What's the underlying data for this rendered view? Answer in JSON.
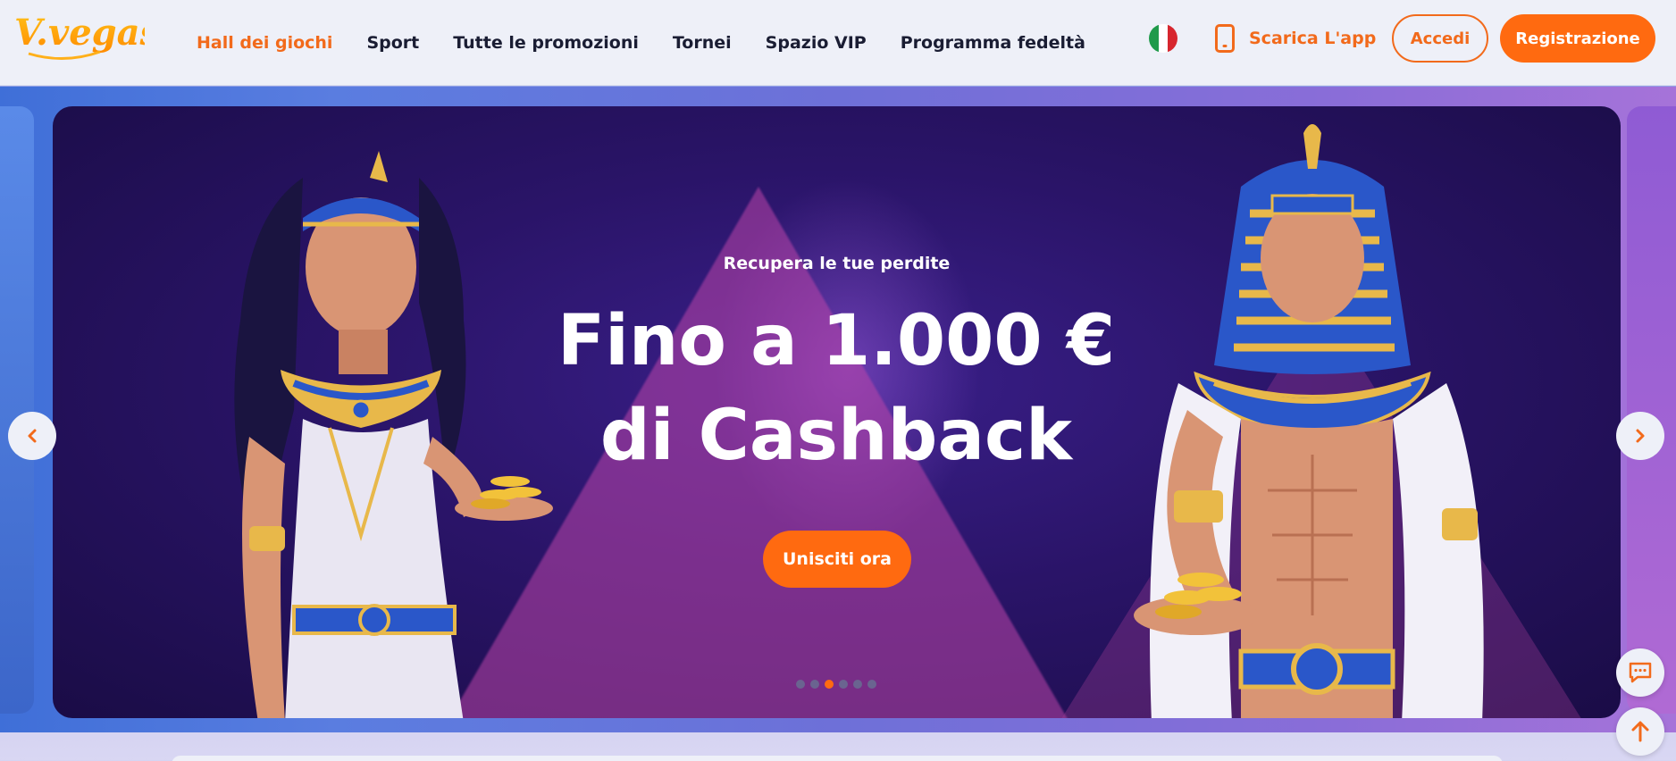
{
  "logo": {
    "text": "V.vegas"
  },
  "nav": {
    "items": [
      {
        "label": "Hall dei giochi",
        "active": true
      },
      {
        "label": "Sport",
        "active": false
      },
      {
        "label": "Tutte le promozioni",
        "active": false
      },
      {
        "label": "Tornei",
        "active": false
      },
      {
        "label": "Spazio VIP",
        "active": false
      },
      {
        "label": "Programma fedeltà",
        "active": false
      }
    ]
  },
  "header": {
    "language_flag": "italy-flag-icon",
    "app_label": "Scarica L'app",
    "login_label": "Accedi",
    "register_label": "Registrazione"
  },
  "hero": {
    "subtitle": "Recupera le tue perdite",
    "title": "Fino a 1.000 € di Cashback",
    "cta_label": "Unisciti ora",
    "slide_count": 6,
    "active_slide": 3
  },
  "colors": {
    "accent": "#ff6a10",
    "nav_active": "#f26a1b",
    "header_bg": "#eef0f8",
    "text_dark": "#1a1d33"
  }
}
